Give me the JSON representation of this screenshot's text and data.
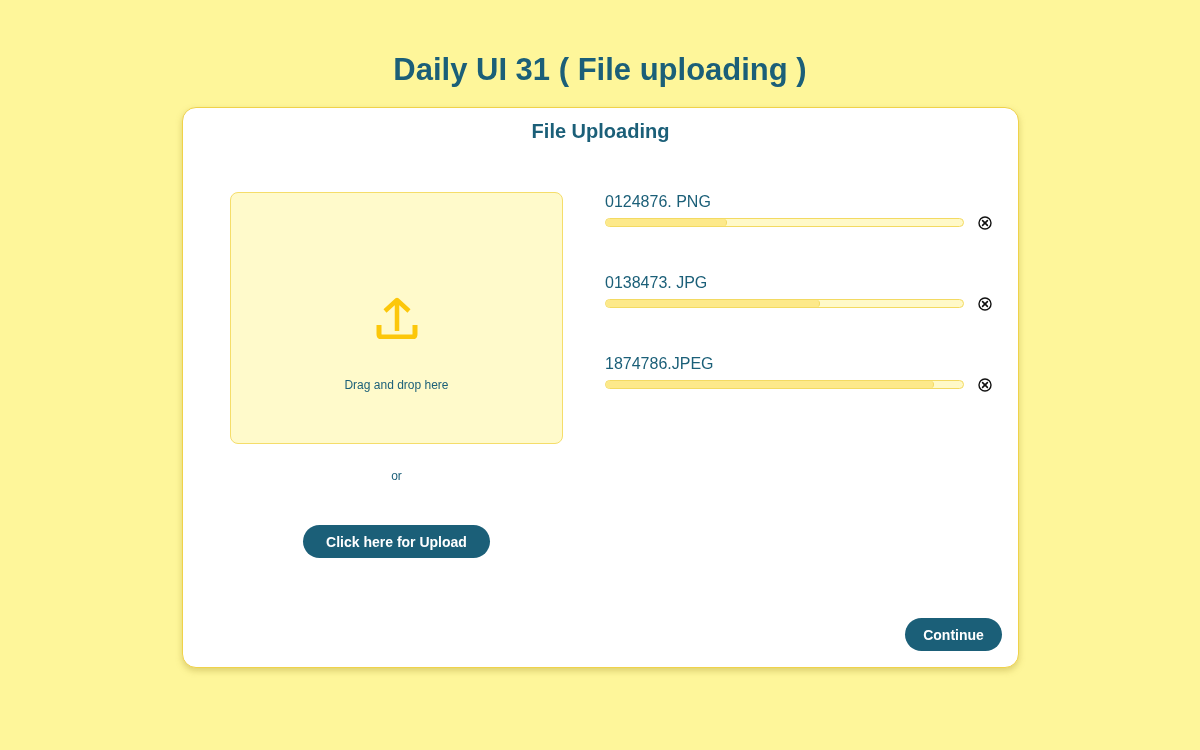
{
  "page_title": "Daily UI 31 ( File uploading )",
  "card": {
    "title": "File Uploading"
  },
  "drop_zone": {
    "label": "Drag and drop here"
  },
  "separator": "or",
  "upload_button": "Click here for Upload",
  "files": [
    {
      "name": "0124876. PNG",
      "level": 0.34
    },
    {
      "name": "0138473. JPG",
      "level": 0.6
    },
    {
      "name": "1874786.JPEG",
      "level": 0.92
    }
  ],
  "continue_button": "Continue"
}
